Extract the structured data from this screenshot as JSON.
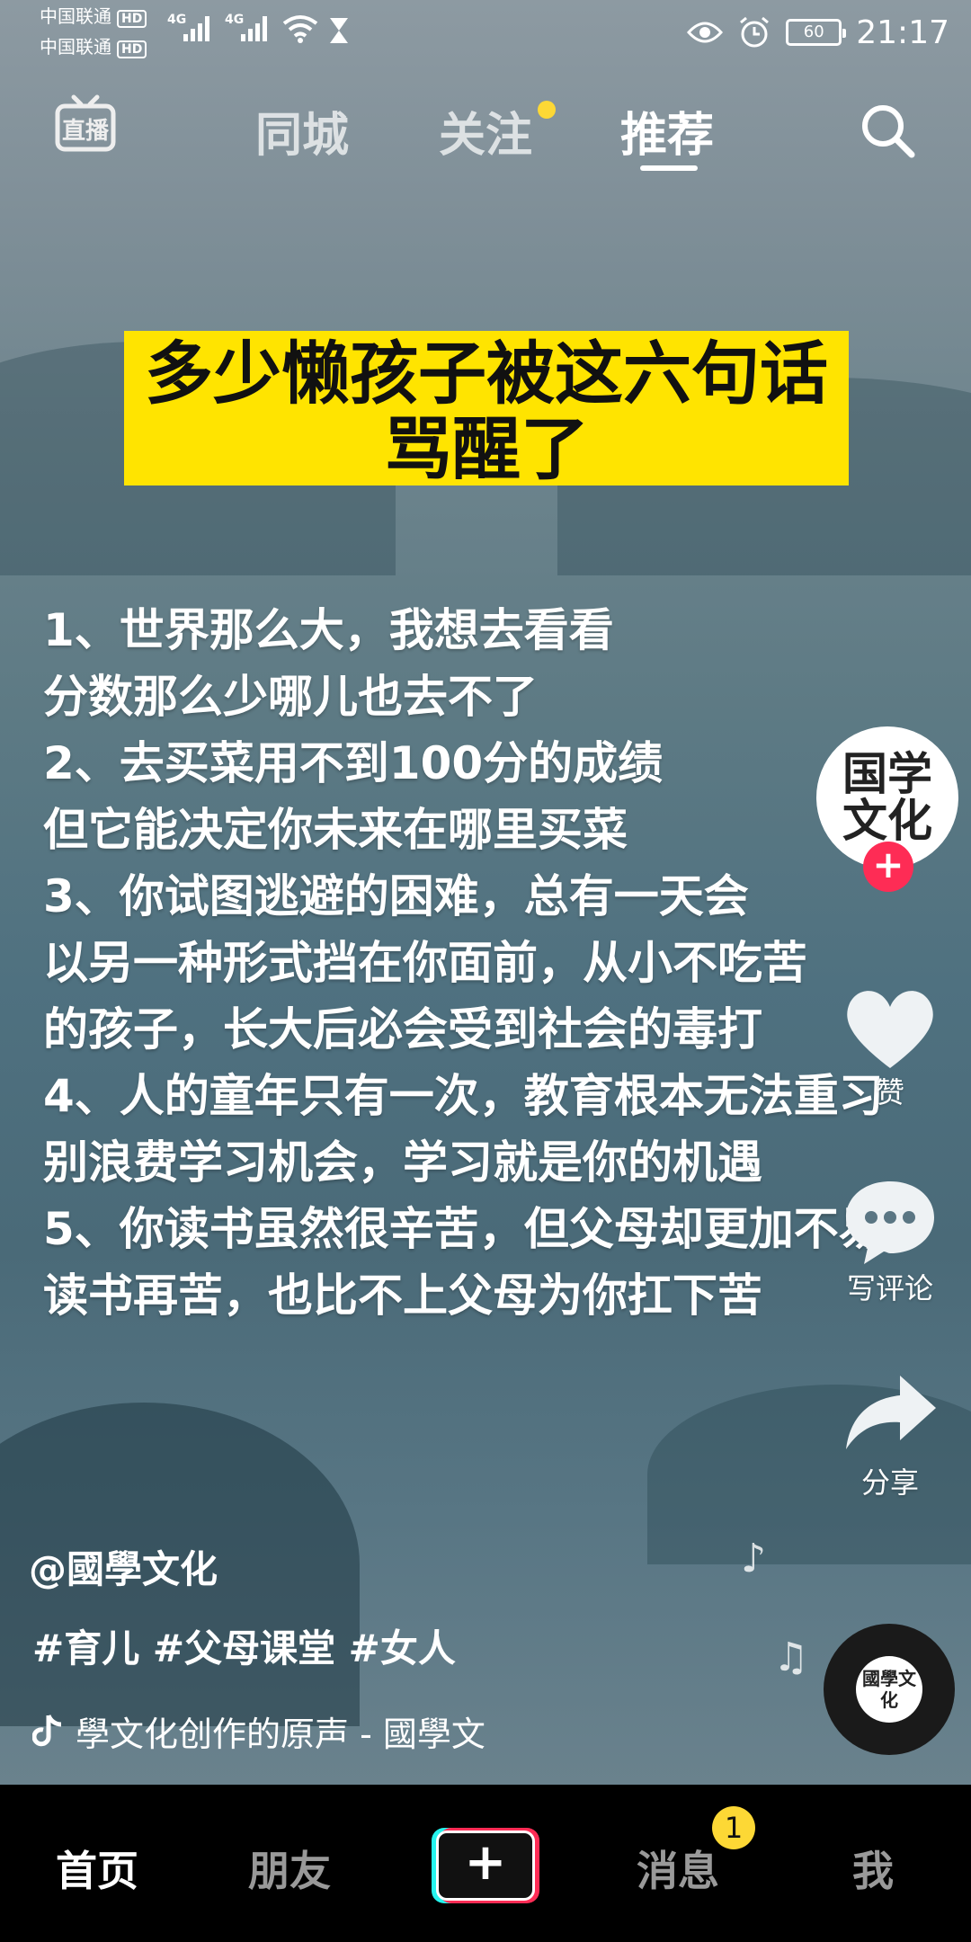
{
  "status_bar": {
    "carrier1": "中国联通",
    "carrier2": "中国联通",
    "hd": "HD",
    "network1": "4G",
    "network2": "4G",
    "battery": "60",
    "time": "21:17"
  },
  "top_nav": {
    "live_label": "直播",
    "tabs": [
      "同城",
      "关注",
      "推荐"
    ],
    "active_tab": "推荐"
  },
  "video": {
    "headline_line1": "多少懒孩子被这六句话",
    "headline_line2": "骂醒了",
    "body_lines": [
      "1、世界那么大，我想去看看",
      "分数那么少哪儿也去不了",
      "2、去买菜用不到100分的成绩",
      "但它能决定你未来在哪里买菜",
      "3、你试图逃避的困难，总有一天会",
      "以另一种形式挡在你面前，从小不吃苦",
      "的孩子，长大后必会受到社会的毒打",
      "4、人的童年只有一次，教育根本无法重习",
      "别浪费学习机会，学习就是你的机遇",
      "5、你读书虽然很辛苦，但父母却更加不易，",
      "读书再苦，也比不上父母为你扛下苦"
    ]
  },
  "right_rail": {
    "avatar_text": "国学文化",
    "follow_symbol": "+",
    "like_label": "赞",
    "comment_label": "写评论",
    "share_label": "分享"
  },
  "info": {
    "author": "@國學文化",
    "tags": "#育儿 #父母课堂 #女人",
    "music": "學文化创作的原声 - 國學文"
  },
  "disc_text": "國學文化",
  "bottom_nav": {
    "home": "首页",
    "friends": "朋友",
    "create": "+",
    "messages": "消息",
    "messages_badge": "1",
    "me": "我"
  },
  "colors": {
    "accent_red": "#fe2c55",
    "accent_cyan": "#25f4ee",
    "headline_bg": "#ffe400",
    "badge_yellow": "#fdd835"
  }
}
